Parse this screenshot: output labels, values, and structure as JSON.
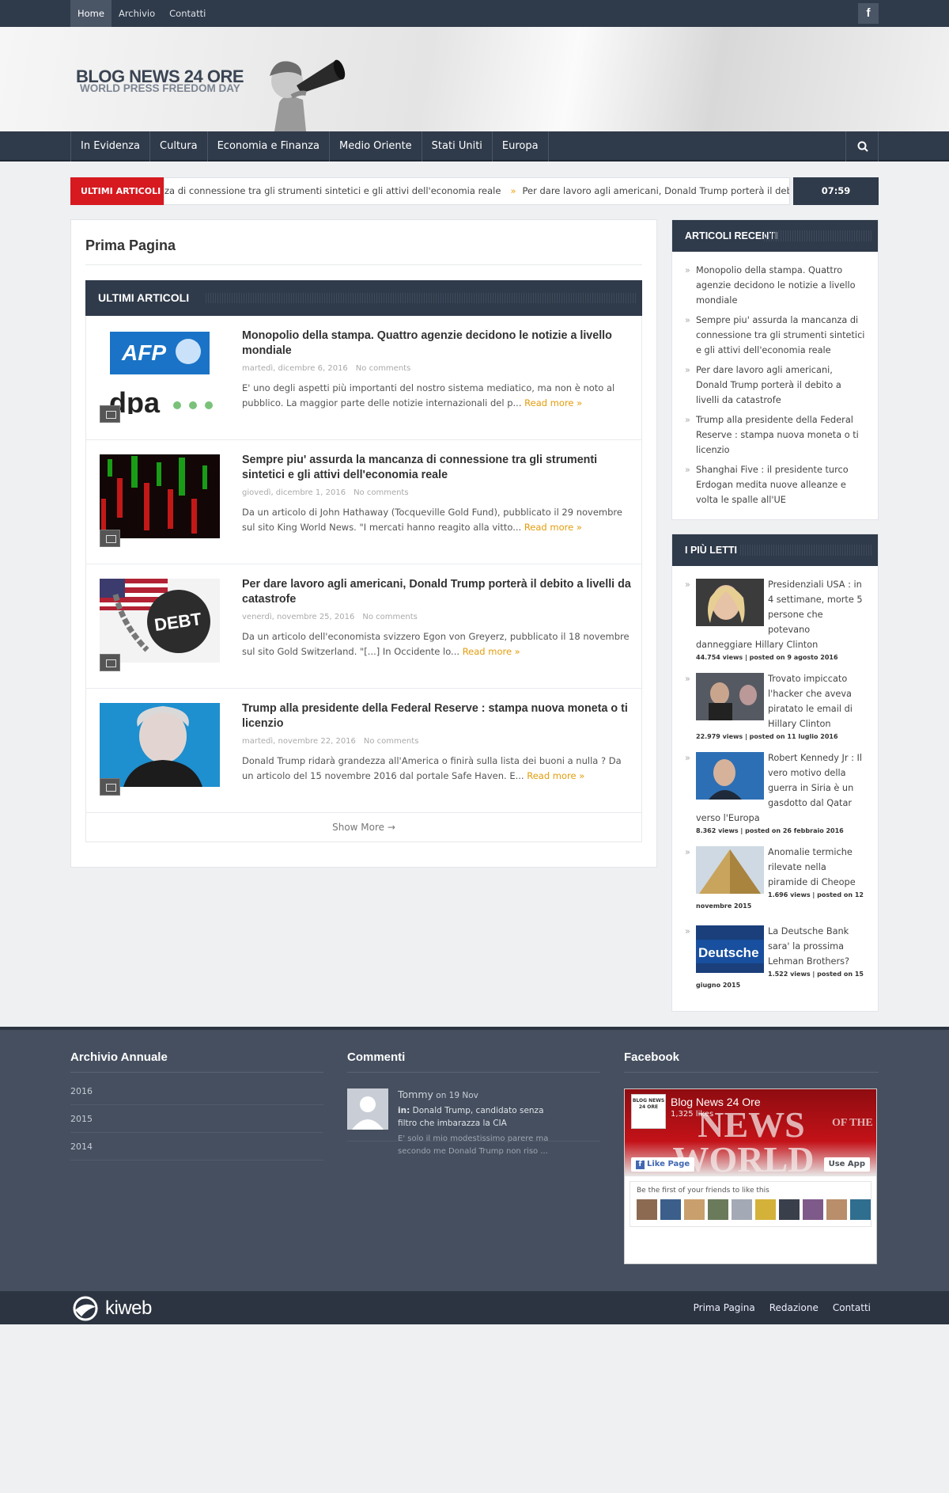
{
  "topnav": {
    "items": [
      "Home",
      "Archivio",
      "Contatti"
    ],
    "facebook_glyph": "f"
  },
  "logo": {
    "line1": "BLOG NEWS 24 ORE",
    "line2": "WORLD PRESS FREEDOM DAY"
  },
  "mainnav": {
    "items": [
      "In Evidenza",
      "Cultura",
      "Economia e Finanza",
      "Medio Oriente",
      "Stati Uniti",
      "Europa"
    ]
  },
  "ticker": {
    "label": "ULTIMI ARTICOLI",
    "item1": "za di connessione tra gli strumenti sintetici e gli attivi dell'economia reale",
    "item2": "Per dare lavoro agli americani, Donald Trump porterà il debito a live",
    "time": "07:59"
  },
  "page": {
    "title": "Prima Pagina",
    "section": "ULTIMI ARTICOLI",
    "show_more": "Show More →"
  },
  "articles": [
    {
      "title": "Monopolio della stampa. Quattro agenzie decidono le notizie a livello mondiale",
      "date": "martedì, dicembre 6, 2016",
      "comments": "No comments",
      "excerpt": "E' uno degli aspetti più importanti del nostro sistema mediatico, ma non è noto al pubblico. La maggior parte delle notizie internazionali del p...",
      "read_more": "Read more »"
    },
    {
      "title": "Sempre piu' assurda la mancanza di connessione tra gli strumenti sintetici e gli attivi dell'economia reale",
      "date": "giovedì, dicembre 1, 2016",
      "comments": "No comments",
      "excerpt": "Da un articolo di John Hathaway (Tocqueville Gold Fund), pubblicato il 29 novembre sul sito King World News. \"I mercati hanno reagito alla vitto...",
      "read_more": "Read more »"
    },
    {
      "title": "Per dare lavoro agli americani, Donald Trump porterà il debito a livelli da catastrofe",
      "date": "venerdì, novembre 25, 2016",
      "comments": "No comments",
      "excerpt": "Da un articolo dell'economista svizzero Egon von Greyerz, pubblicato il 18 novembre sul sito Gold Switzerland. \"[...] In Occidente lo...",
      "read_more": "Read more »"
    },
    {
      "title": "Trump alla presidente della Federal Reserve : stampa nuova moneta o ti licenzio",
      "date": "martedì, novembre 22, 2016",
      "comments": "No comments",
      "excerpt": "Donald Trump ridarà grandezza all'America o finirà sulla lista dei buoni a nulla ? Da un articolo del 15 novembre 2016 dal portale Safe Haven. E...",
      "read_more": "Read more »"
    }
  ],
  "thumb_text": {
    "afp": "AFP",
    "dpa": "dpa",
    "debt": "DEBT"
  },
  "recent": {
    "title": "ARTICOLI RECENTI",
    "items": [
      "Monopolio della stampa. Quattro agenzie decidono le notizie a livello mondiale",
      "Sempre piu' assurda la mancanza di connessione tra gli strumenti sintetici e gli attivi dell'economia reale",
      "Per dare lavoro agli americani, Donald Trump porterà il debito a livelli da catastrofe",
      "Trump alla presidente della Federal Reserve : stampa nuova moneta o ti licenzio",
      "Shanghai Five : il presidente turco Erdogan medita nuove alleanze e volta le spalle all'UE"
    ]
  },
  "popular": {
    "title": "I PIÙ LETTI",
    "items": [
      {
        "title": "Presidenziali USA : in 4 settimane, morte 5 persone che potevano danneggiare Hillary Clinton",
        "views": "44.754 views | posted on 9 agosto 2016"
      },
      {
        "title": "Trovato impiccato l'hacker che aveva piratato le email di Hillary Clinton",
        "views": "22.979 views | posted on 11 luglio 2016"
      },
      {
        "title": "Robert Kennedy Jr : Il vero motivo della guerra in Siria è un gasdotto dal Qatar verso l'Europa",
        "views": "8.362 views | posted on 26 febbraio 2016"
      },
      {
        "title": "Anomalie termiche rilevate nella piramide di Cheope",
        "views": "1.696 views | posted on 12 novembre 2015"
      },
      {
        "title": "La Deutsche Bank sara' la prossima Lehman Brothers?",
        "views": "1.522 views | posted on 15 giugno 2015"
      }
    ],
    "deutsche_text": "Deutsche"
  },
  "footer": {
    "archive": {
      "title": "Archivio Annuale",
      "years": [
        "2016",
        "2015",
        "2014"
      ]
    },
    "comments": {
      "title": "Commenti",
      "author": "Tommy",
      "on": "on 19 Nov",
      "in_label": "in:",
      "post": "Donald Trump, candidato senza filtro che imbarazza la CIA",
      "text": "E' solo il mio modestissimo parere ma secondo me Donald Trump non riso ..."
    },
    "facebook": {
      "title": "Facebook",
      "page_name": "Blog News 24 Ore",
      "likes": "1,325 likes",
      "like_btn": "Like Page",
      "app_btn": "Use App",
      "friends": "Be the first of your friends to like this",
      "banner_big": "NEWS",
      "banner_of": "OF THE",
      "banner_world": "WORLD",
      "logo_small": "BLOG NEWS 24 ORE"
    }
  },
  "bottom": {
    "brand": "kiweb",
    "links": [
      "Prima Pagina",
      "Redazione",
      "Contatti"
    ]
  },
  "colors": {
    "accent": "#e39c0b",
    "ticker_red": "#d71920",
    "navy": "#2f3a4a"
  }
}
